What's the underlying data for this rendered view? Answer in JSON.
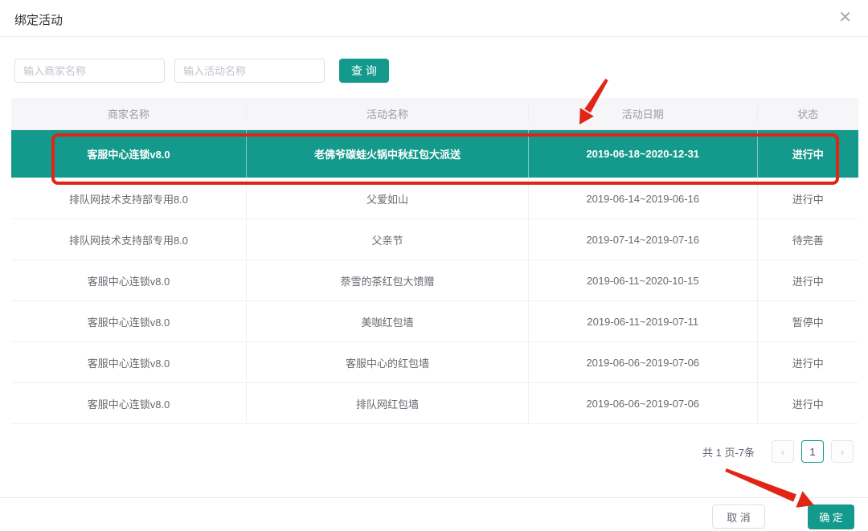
{
  "dialog": {
    "title": "绑定活动",
    "close_glyph": "✕"
  },
  "filters": {
    "merchant_placeholder": "输入商家名称",
    "activity_placeholder": "输入活动名称",
    "search_label": "查 询"
  },
  "table": {
    "columns": [
      "商家名称",
      "活动名称",
      "活动日期",
      "状态"
    ],
    "rows": [
      {
        "merchant": "客服中心连锁v8.0",
        "activity": "老佛爷碳蛙火锅中秋红包大派送",
        "dates": "2019-06-18~2020-12-31",
        "status": "进行中",
        "selected": true
      },
      {
        "merchant": "排队网技术支持部专用8.0",
        "activity": "父爱如山",
        "dates": "2019-06-14~2019-06-16",
        "status": "进行中",
        "selected": false
      },
      {
        "merchant": "排队网技术支持部专用8.0",
        "activity": "父亲节",
        "dates": "2019-07-14~2019-07-16",
        "status": "待完善",
        "selected": false
      },
      {
        "merchant": "客服中心连锁v8.0",
        "activity": "萘雪的茶红包大馈赠",
        "dates": "2019-06-11~2020-10-15",
        "status": "进行中",
        "selected": false
      },
      {
        "merchant": "客服中心连锁v8.0",
        "activity": "美咖红包墙",
        "dates": "2019-06-11~2019-07-11",
        "status": "暂停中",
        "selected": false
      },
      {
        "merchant": "客服中心连锁v8.0",
        "activity": "客服中心的红包墙",
        "dates": "2019-06-06~2019-07-06",
        "status": "进行中",
        "selected": false
      },
      {
        "merchant": "客服中心连锁v8.0",
        "activity": "排队网红包墙",
        "dates": "2019-06-06~2019-07-06",
        "status": "进行中",
        "selected": false
      }
    ]
  },
  "pagination": {
    "summary": "共 1 页-7条",
    "prev_glyph": "‹",
    "page": "1",
    "next_glyph": "›"
  },
  "footer": {
    "cancel_label": "取 消",
    "confirm_label": "确 定"
  },
  "colors": {
    "accent": "#149a8c",
    "annotation": "#e02516",
    "header_bg": "#f6f6f8"
  }
}
